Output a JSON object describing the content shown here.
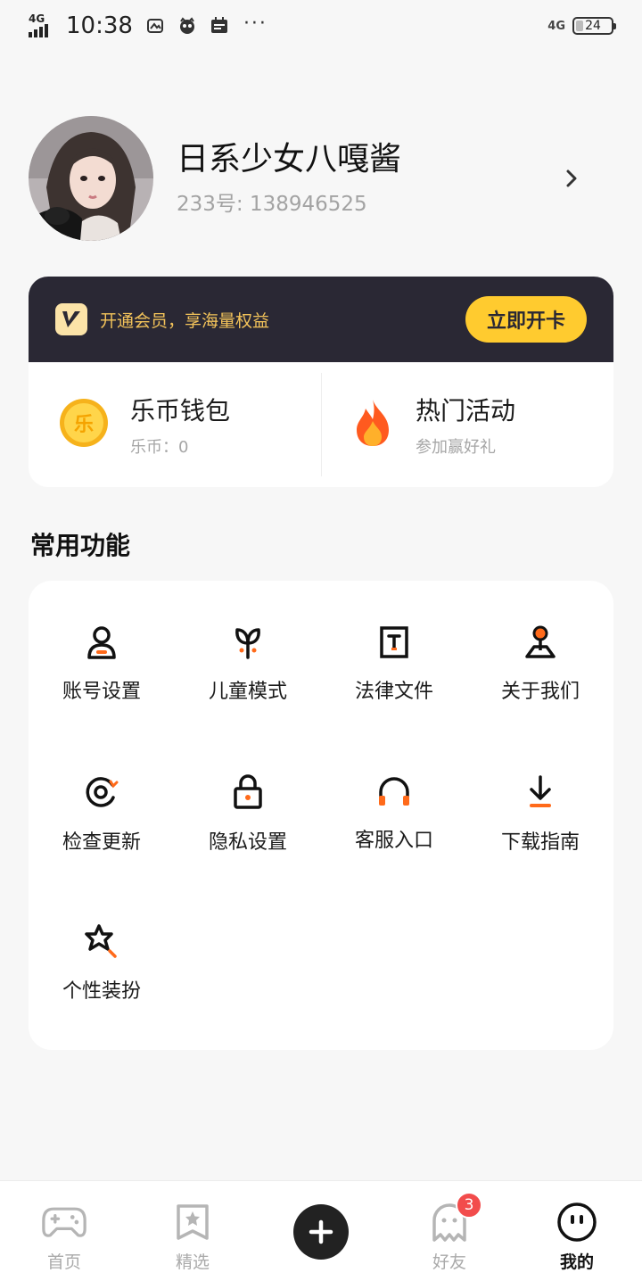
{
  "status_bar": {
    "network": "4G",
    "time": "10:38",
    "right_network": "4G",
    "battery": "24"
  },
  "profile": {
    "username": "日系少女八嘎酱",
    "user_id": "233号: 138946525"
  },
  "member": {
    "promo_text": "开通会员，享海量权益",
    "cta_label": "立即开卡",
    "wallet_title": "乐币钱包",
    "wallet_sub": "乐币：0",
    "wallet_icon_char": "乐",
    "activity_title": "热门活动",
    "activity_sub": "参加赢好礼"
  },
  "functions": {
    "title": "常用功能",
    "items": [
      {
        "label": "账号设置",
        "icon": "account-icon"
      },
      {
        "label": "儿童模式",
        "icon": "sprout-icon"
      },
      {
        "label": "法律文件",
        "icon": "document-icon"
      },
      {
        "label": "关于我们",
        "icon": "location-pin-icon"
      },
      {
        "label": "检查更新",
        "icon": "refresh-icon"
      },
      {
        "label": "隐私设置",
        "icon": "lock-icon"
      },
      {
        "label": "客服入口",
        "icon": "headphones-icon"
      },
      {
        "label": "下载指南",
        "icon": "download-icon"
      },
      {
        "label": "个性装扮",
        "icon": "star-wand-icon"
      }
    ]
  },
  "bottom_nav": {
    "home": "首页",
    "featured": "精选",
    "friends": "好友",
    "friends_badge": "3",
    "mine": "我的"
  },
  "colors": {
    "accent": "#ff6a1a",
    "vip_gold": "#ffcb2f",
    "vip_dark": "#2a2834",
    "badge_red": "#f24c4c"
  }
}
